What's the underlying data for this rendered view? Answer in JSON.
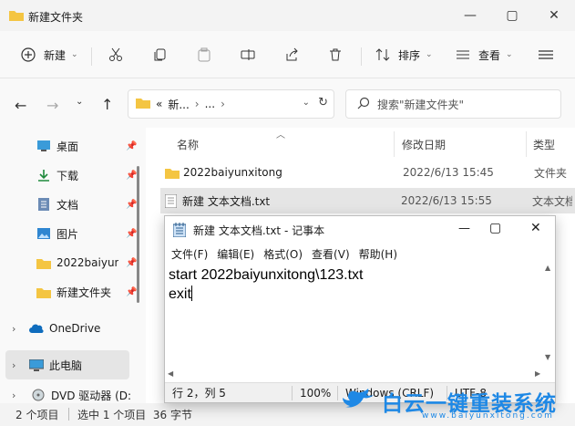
{
  "window": {
    "title": "新建文件夹"
  },
  "toolbar": {
    "new_label": "新建",
    "sort_label": "排序",
    "view_label": "查看",
    "more_label": "···"
  },
  "address": {
    "crumb1": "«",
    "crumb2": "新...",
    "crumb3": "...",
    "sep": "›"
  },
  "search": {
    "placeholder": "搜索\"新建文件夹\""
  },
  "sidebar": {
    "items": [
      {
        "label": "桌面",
        "icon": "desktop-icon"
      },
      {
        "label": "下载",
        "icon": "download-icon"
      },
      {
        "label": "文档",
        "icon": "document-icon"
      },
      {
        "label": "图片",
        "icon": "picture-icon"
      },
      {
        "label": "2022baiyun",
        "icon": "folder-icon"
      },
      {
        "label": "新建文件夹",
        "icon": "folder-icon"
      }
    ],
    "onedrive": "OneDrive",
    "thispc": "此电脑",
    "dvd": "DVD 驱动器 (D:"
  },
  "columns": {
    "name": "名称",
    "date": "修改日期",
    "type": "类型"
  },
  "files": [
    {
      "name": "2022baiyunxitong",
      "date": "2022/6/13 15:45",
      "type": "文件夹"
    },
    {
      "name": "新建 文本文档.txt",
      "date": "2022/6/13 15:55",
      "type": "文本文档"
    }
  ],
  "status": {
    "items": "2 个项目",
    "selected": "选中 1 个项目  36 字节"
  },
  "notepad": {
    "title": "新建 文本文档.txt - 记事本",
    "menu": [
      "文件(F)",
      "编辑(E)",
      "格式(O)",
      "查看(V)",
      "帮助(H)"
    ],
    "line1": "start 2022baiyunxitong\\123.txt",
    "line2": "exit",
    "status_pos": "行 2，列 5",
    "status_zoom": "100%",
    "status_eol": "Windows (CRLF)",
    "status_enc": "UTF-8"
  },
  "watermark": {
    "brand": "白云一键重装系统",
    "url": "www.baiyunxitong.com"
  },
  "colors": {
    "accent": "#1e88e5",
    "folder": "#f4c542",
    "selected_row": "#e5e5e5"
  }
}
